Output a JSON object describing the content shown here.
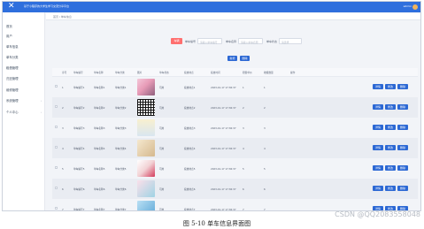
{
  "window": {
    "title": "基于小程序的大学生学习交流分享平台",
    "user": "admin",
    "close_icon": "close-icon"
  },
  "sidebar": [
    {
      "label": "首页",
      "icon": "home-icon"
    },
    {
      "label": "用户",
      "icon": "user-icon"
    },
    {
      "label": "单车信息",
      "icon": "bike-icon"
    },
    {
      "label": "单车分类",
      "icon": "category-icon"
    },
    {
      "label": "租借管理",
      "icon": "lease-icon"
    },
    {
      "label": "归还管理",
      "icon": "return-icon"
    },
    {
      "label": "维修管理",
      "icon": "repair-icon"
    },
    {
      "label": "系统管理",
      "icon": "settings-icon",
      "has_submenu": true
    },
    {
      "label": "个人中心",
      "icon": "profile-icon",
      "has_submenu": true
    }
  ],
  "breadcrumb": "首页 / 单车信息",
  "filters": {
    "chip": "车辆",
    "fields": [
      {
        "label": "单车编号",
        "placeholder": "请输入单车编号"
      },
      {
        "label": "单车名称",
        "placeholder": "请输入单车名称"
      },
      {
        "label": "单车状态",
        "placeholder": "请选择"
      }
    ],
    "search_label": "查询",
    "add_label": "新增",
    "delete_label": "删除"
  },
  "table": {
    "columns": [
      "",
      "序号",
      "单车编号",
      "单车名称",
      "单车分类",
      "图片",
      "单车状态",
      "投放地点",
      "投放时间",
      "租借单价",
      "收藏数量",
      "操作"
    ],
    "rows": [
      {
        "no": "1",
        "code": "单车编号1",
        "name": "单车名称1",
        "category": "单车分类1",
        "status": "可用",
        "place": "投放地点1",
        "time": "2023-01-17 17:36:37",
        "price": "1",
        "fav": "1"
      },
      {
        "no": "2",
        "code": "单车编号2",
        "name": "单车名称2",
        "category": "单车分类2",
        "status": "可用",
        "place": "投放地点2",
        "time": "2023-01-17 17:36:37",
        "price": "2",
        "fav": "2"
      },
      {
        "no": "3",
        "code": "单车编号3",
        "name": "单车名称3",
        "category": "单车分类3",
        "status": "可用",
        "place": "投放地点3",
        "time": "2023-01-17 17:36:37",
        "price": "3",
        "fav": "3"
      },
      {
        "no": "4",
        "code": "单车编号4",
        "name": "单车名称4",
        "category": "单车分类4",
        "status": "可用",
        "place": "投放地点4",
        "time": "2023-01-17 17:36:37",
        "price": "4",
        "fav": "4"
      },
      {
        "no": "5",
        "code": "单车编号5",
        "name": "单车名称5",
        "category": "单车分类5",
        "status": "可用",
        "place": "投放地点5",
        "time": "2023-01-17 17:36:37",
        "price": "5",
        "fav": "5"
      },
      {
        "no": "6",
        "code": "单车编号6",
        "name": "单车名称6",
        "category": "单车分类6",
        "status": "可用",
        "place": "投放地点6",
        "time": "2023-01-17 17:36:37",
        "price": "6",
        "fav": "6"
      },
      {
        "no": "7",
        "code": "单车编号7",
        "name": "单车名称7",
        "category": "单车分类7",
        "status": "可用",
        "place": "投放地点7",
        "time": "2023-01-17 17:36:37",
        "price": "7",
        "fav": "7"
      }
    ],
    "actions": [
      "详情",
      "修改",
      "删除"
    ]
  },
  "caption": "图 5-10 单车信息界面图",
  "watermark": "CSDN @QQ2083558048",
  "colors": {
    "topbar": "#2f6fdd",
    "primary_button": "#2c68d4",
    "chip": "#ff6f6f"
  }
}
